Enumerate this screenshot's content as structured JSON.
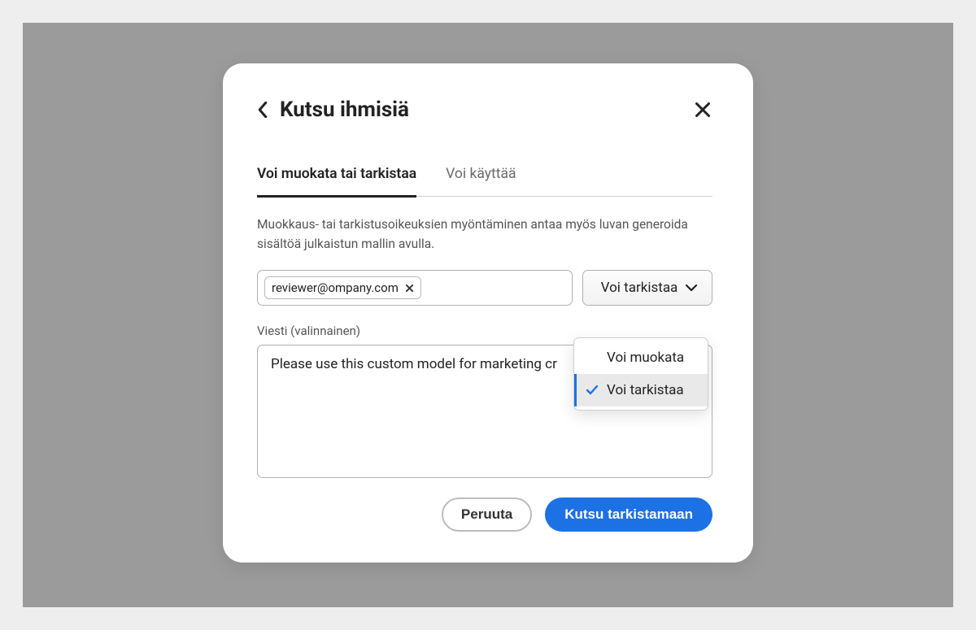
{
  "dialog": {
    "title": "Kutsu ihmisiä"
  },
  "tabs": {
    "edit": "Voi muokata tai tarkistaa",
    "use": "Voi käyttää"
  },
  "help_text": "Muokkaus- tai tarkistusoikeuksien myöntäminen antaa myös luvan generoida sisältöä julkaistun mallin avulla.",
  "email_chip": "reviewer@ompany.com",
  "permission": {
    "selected_label": "Voi tarkistaa",
    "options": {
      "edit": "Voi muokata",
      "review": "Voi tarkistaa"
    }
  },
  "message": {
    "label": "Viesti (valinnainen)",
    "value": "Please use this custom model for marketing cr"
  },
  "buttons": {
    "cancel": "Peruuta",
    "submit": "Kutsu tarkistamaan"
  }
}
